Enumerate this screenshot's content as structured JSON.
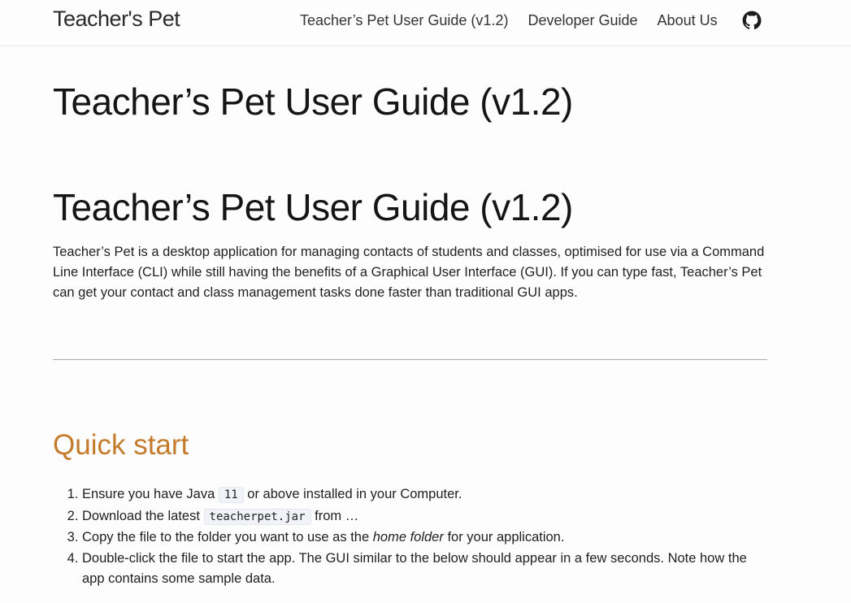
{
  "nav": {
    "brand": "Teacher's Pet",
    "links": [
      "Teacher’s Pet User Guide (v1.2)",
      "Developer Guide",
      "About Us"
    ],
    "github_icon": "github-icon"
  },
  "page": {
    "site_title": "Teacher’s Pet User Guide (v1.2)",
    "doc_title": "Teacher’s Pet User Guide (v1.2)",
    "intro": "Teacher’s Pet is a desktop application for managing contacts of students and classes, optimised for use via a Command Line Interface (CLI) while still having the benefits of a Graphical User Interface (GUI). If you can type fast, Teacher’s Pet can get your contact and class management tasks done faster than traditional GUI apps."
  },
  "quick_start": {
    "heading": "Quick start",
    "heading_color": "#c47b2b",
    "step1": {
      "pre": "Ensure you have Java ",
      "code": "11",
      "post": " or above installed in your Computer."
    },
    "step2": {
      "pre": "Download the latest ",
      "code": "teacherpet.jar",
      "post": " from …"
    },
    "step3": {
      "pre": "Copy the file to the folder you want to use as the ",
      "em": "home folder",
      "post": " for your application."
    },
    "step4": "Double-click the file to start the app. The GUI similar to the below should appear in a few seconds. Note how the app contains some sample data."
  }
}
